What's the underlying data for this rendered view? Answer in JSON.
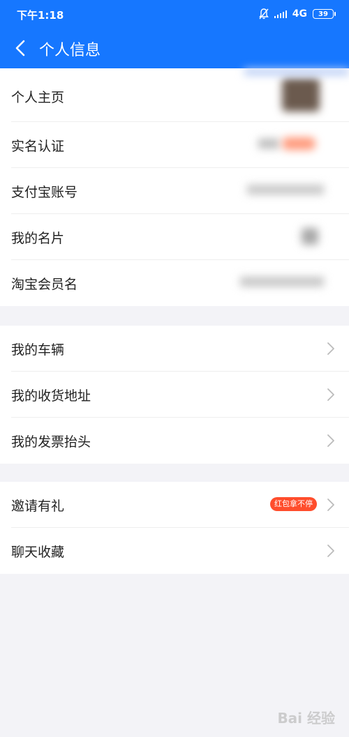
{
  "status_bar": {
    "time": "下午1:18",
    "network": "4G",
    "battery": "39"
  },
  "header": {
    "title": "个人信息",
    "back_icon": "chevron-left-icon"
  },
  "profile_section": {
    "items": [
      {
        "label": "个人主页"
      },
      {
        "label": "实名认证"
      },
      {
        "label": "支付宝账号"
      },
      {
        "label": "我的名片"
      },
      {
        "label": "淘宝会员名"
      }
    ]
  },
  "address_section": {
    "items": [
      {
        "label": "我的车辆"
      },
      {
        "label": "我的收货地址"
      },
      {
        "label": "我的发票抬头"
      }
    ]
  },
  "other_section": {
    "items": [
      {
        "label": "邀请有礼",
        "badge": "红包拿不停"
      },
      {
        "label": "聊天收藏"
      }
    ]
  },
  "watermark": "Bai 经验",
  "colors": {
    "brand": "#1677ff",
    "badge": "#ff4d2c",
    "background": "#f3f3f7"
  }
}
